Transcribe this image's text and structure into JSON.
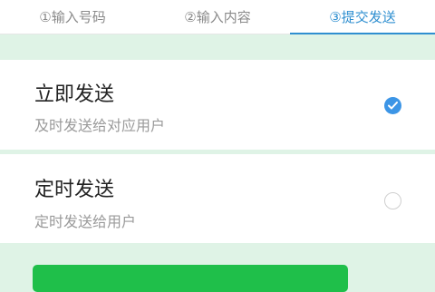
{
  "steps": [
    {
      "label": "①输入号码",
      "active": false
    },
    {
      "label": "②输入内容",
      "active": false
    },
    {
      "label": "③提交发送",
      "active": true
    }
  ],
  "options": [
    {
      "title": "立即发送",
      "description": "及时发送给对应用户",
      "selected": true
    },
    {
      "title": "定时发送",
      "description": "定时发送给用户",
      "selected": false
    }
  ],
  "colors": {
    "accent": "#2f8fd0",
    "radio_checked": "#3c95e6",
    "background": "#dff3e6",
    "button": "#1fbf4a"
  }
}
